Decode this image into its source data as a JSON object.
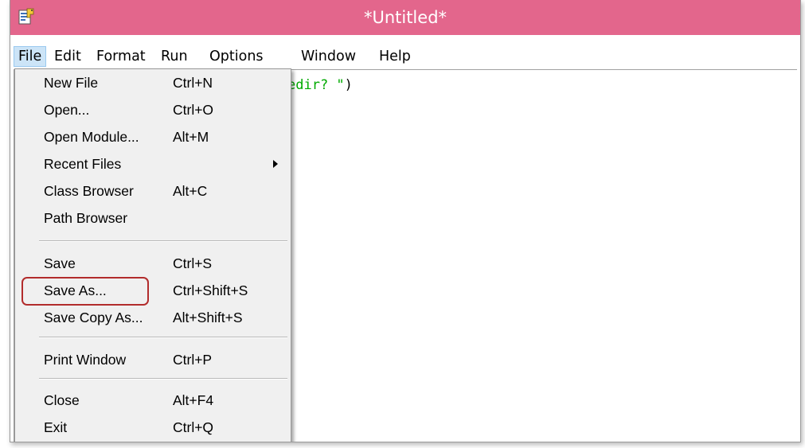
{
  "window": {
    "title": "*Untitled*",
    "titlebar_color": "#e3668c",
    "icon": "python-idle-icon"
  },
  "menubar": {
    "items": [
      "File",
      "Edit",
      "Format",
      "Run",
      "Options",
      "Window",
      "Help"
    ],
    "active": "File"
  },
  "editor": {
    "visible_code_fragment": "edir? \")",
    "string_color": "#00aa00"
  },
  "file_menu": {
    "items": [
      {
        "label": "New File",
        "shortcut": "Ctrl+N"
      },
      {
        "label": "Open...",
        "shortcut": "Ctrl+O"
      },
      {
        "label": "Open Module...",
        "shortcut": "Alt+M"
      },
      {
        "label": "Recent Files",
        "shortcut": "",
        "submenu_icon": "submenu-arrow-icon"
      },
      {
        "label": "Class Browser",
        "shortcut": "Alt+C"
      },
      {
        "label": "Path Browser",
        "shortcut": ""
      },
      {
        "label": "Save",
        "shortcut": "Ctrl+S"
      },
      {
        "label": "Save As...",
        "shortcut": "Ctrl+Shift+S",
        "highlighted": true
      },
      {
        "label": "Save Copy As...",
        "shortcut": "Alt+Shift+S"
      },
      {
        "label": "Print Window",
        "shortcut": "Ctrl+P"
      },
      {
        "label": "Close",
        "shortcut": "Alt+F4"
      },
      {
        "label": "Exit",
        "shortcut": "Ctrl+Q"
      }
    ],
    "highlight_color": "#b22c2c"
  }
}
